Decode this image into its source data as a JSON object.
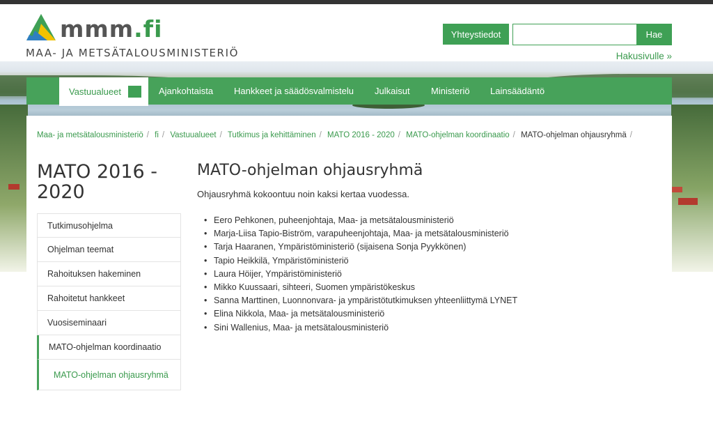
{
  "header": {
    "logo_name": "mmm",
    "logo_suffix": ".fi",
    "tagline": "MAA- JA METSÄTALOUSMINISTERIÖ",
    "contact_label": "Yhteystiedot",
    "search_value": "",
    "search_button": "Hae",
    "advanced_search": "Hakusivulle »"
  },
  "nav": {
    "items": [
      {
        "label": "Vastuualueet",
        "active": true
      },
      {
        "label": "Ajankohtaista"
      },
      {
        "label": "Hankkeet ja säädösvalmistelu"
      },
      {
        "label": "Julkaisut"
      },
      {
        "label": "Ministeriö"
      },
      {
        "label": "Lainsäädäntö"
      }
    ]
  },
  "breadcrumb": [
    "Maa- ja metsätalousministeriö",
    "fi",
    "Vastuualueet",
    "Tutkimus ja kehittäminen",
    "MATO 2016 - 2020",
    "MATO-ohjelman koordinaatio",
    "MATO-ohjelman ohjausryhmä"
  ],
  "sidebar": {
    "title": "MATO 2016 - 2020",
    "items": [
      {
        "label": "Tutkimusohjelma"
      },
      {
        "label": "Ohjelman teemat"
      },
      {
        "label": "Rahoituksen hakeminen"
      },
      {
        "label": "Rahoitetut hankkeet"
      },
      {
        "label": "Vuosiseminaari"
      },
      {
        "label": "MATO-ohjelman koordinaatio"
      },
      {
        "label": "MATO-ohjelman ohjausryhmä"
      }
    ]
  },
  "main": {
    "title": "MATO-ohjelman ohjausryhmä",
    "intro": "Ohjausryhmä kokoontuu noin kaksi kertaa vuodessa.",
    "members": [
      "Eero Pehkonen, puheenjohtaja, Maa- ja metsätalousministeriö",
      "Marja-Liisa Tapio-Biström, varapuheenjohtaja, Maa- ja metsätalousministeriö",
      "Tarja Haaranen, Ympäristöministeriö (sijaisena Sonja Pyykkönen)",
      "Tapio Heikkilä, Ympäristöministeriö",
      "Laura Höijer, Ympäristöministeriö",
      "Mikko Kuussaari, sihteeri, Suomen ympäristökeskus",
      "Sanna Marttinen, Luonnonvara- ja ympäristötutkimuksen yhteenliittymä LYNET",
      "Elina Nikkola, Maa- ja metsätalousministeriö",
      "Sini Wallenius, Maa- ja metsätalousministeriö"
    ]
  },
  "colors": {
    "brand_green": "#47a25a",
    "link_green": "#3a9a4d",
    "text": "#333333"
  }
}
